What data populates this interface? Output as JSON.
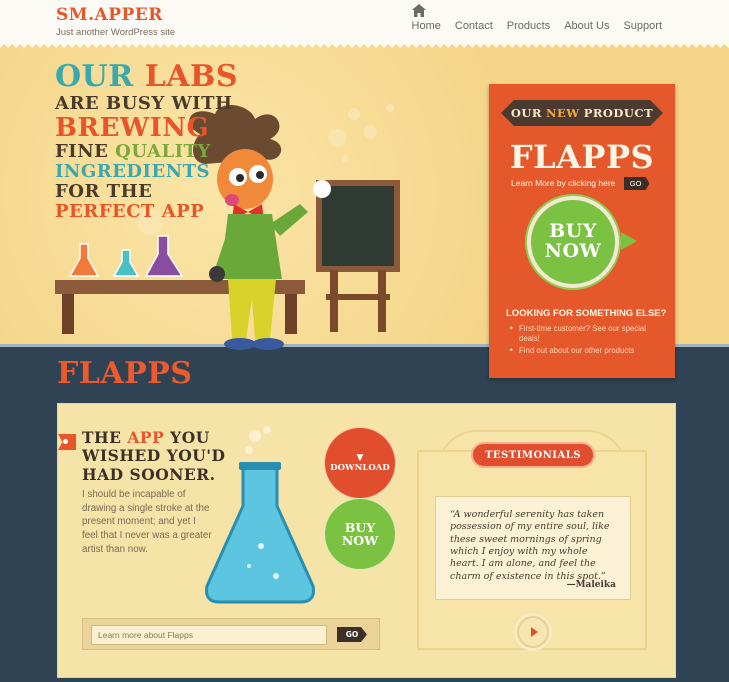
{
  "header": {
    "logo": "SM.APPER",
    "tagline": "Just another WordPress site",
    "nav": [
      "Home",
      "Contact",
      "Products",
      "About Us",
      "Support"
    ]
  },
  "hero": {
    "line1a": "OUR",
    "line1b": "LABS",
    "line2": "ARE BUSY WITH",
    "line3": "BREWING",
    "line4a": "FINE",
    "line4b": "QUALITY",
    "line5": "INGREDIENTS",
    "line6": "FOR THE",
    "line7": "PERFECT APP"
  },
  "product_box": {
    "ribbon_a": "OUR",
    "ribbon_b": "NEW",
    "ribbon_c": "PRODUCT",
    "title": "FLAPPS",
    "learn": "Learn More by clicking here",
    "go": "GO",
    "buy_1": "BUY",
    "buy_2": "NOW",
    "looking": "LOOKING FOR SOMETHING ELSE?",
    "link1": "First-time customer? See our special deals!",
    "link2": "Find out about our other products"
  },
  "main": {
    "section_title": "FLAPPS",
    "head_a": "THE",
    "head_b": "APP",
    "head_c": "YOU WISHED YOU'D HAD SOONER.",
    "desc": "I should be incapable of drawing a single stroke at the present moment; and yet I feel that I never was a greater artist than now.",
    "download": "DOWNLOAD",
    "buy_1": "BUY",
    "buy_2": "NOW",
    "learn_placeholder": "Learn more about Flapps",
    "go": "GO"
  },
  "testimonials": {
    "tag": "TESTIMONIALS",
    "quote": "“A wonderful serenity has taken possession of my entire soul, like these sweet mornings of spring which I enjoy with my whole heart. I am alone, and feel the charm of existence in this spot.”",
    "author": "—Maleika"
  },
  "colors": {
    "accent": "#e8552a",
    "teal": "#3aa9ae",
    "green": "#7cc242",
    "dark_bg": "#2f4354",
    "hero_bg": "#f4d486"
  },
  "icons": [
    "home-icon",
    "arrow-right-icon",
    "flask-icon",
    "scientist-illustration",
    "chalkboard-icon",
    "download-arrow-icon"
  ]
}
